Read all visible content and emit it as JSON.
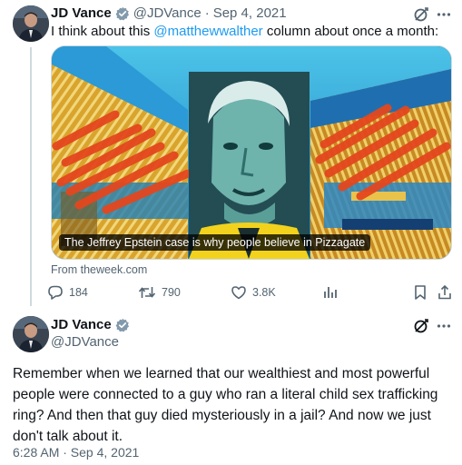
{
  "tweet1": {
    "display_name": "JD Vance",
    "handle": "@JDVance",
    "separator": "·",
    "date": "Sep 4, 2021",
    "text_before": "I think about this ",
    "mention": "@matthewwalther",
    "text_after": " column about once a month:",
    "card": {
      "caption": "The Jeffrey Epstein case is why people believe in Pizzagate",
      "source": "From theweek.com"
    },
    "actions": {
      "replies": "184",
      "reposts": "790",
      "likes": "3.8K"
    }
  },
  "tweet2": {
    "display_name": "JD Vance",
    "handle": "@JDVance",
    "text": "Remember when we learned that our wealthiest and most powerful people were connected to a guy who ran a literal child sex trafficking ring? And then that guy died mysteriously in a jail? And now we just don't talk about it.",
    "timestamp": "6:28 AM · Sep 4, 2021"
  },
  "icons": [
    "verified-badge-icon",
    "grok-icon",
    "more-icon",
    "reply-icon",
    "repost-icon",
    "like-icon",
    "views-icon",
    "bookmark-icon",
    "share-icon"
  ],
  "colors": {
    "accent": "#1d9bf0",
    "muted": "#536471",
    "text": "#0f1419",
    "border": "#cfd9de"
  }
}
